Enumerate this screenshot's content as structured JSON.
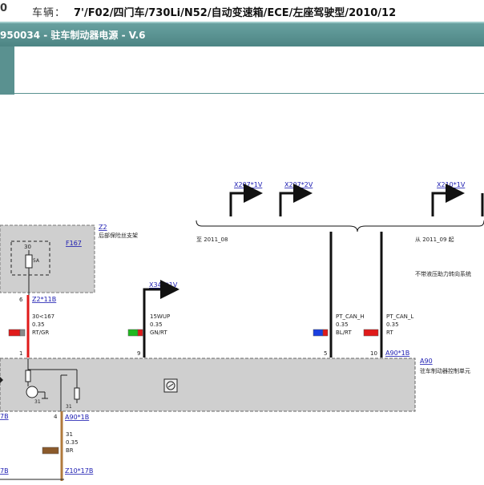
{
  "header": {
    "left_mark": "0",
    "vehicle_label": "车辆：",
    "vehicle_value": "7'/F02/四门车/730Li/N52/自动变速箱/ECE/左座驾驶型/2010/12"
  },
  "title": "950034 - 驻车制动器电源 - V.6",
  "connectors_top": [
    "X207*1V",
    "X207*2V",
    "X210*1V"
  ],
  "notes": {
    "until": "至 2011_08",
    "from": "从 2011_09 起",
    "no_hydraulic": "不带液压助力转向系统"
  },
  "z2": {
    "id": "Z2",
    "desc": "后部保险丝支架",
    "fuse_ref": "F167",
    "pin_top": "30",
    "fuse_rating": "5A",
    "pin_out": "6",
    "conn": "Z2*11B"
  },
  "x344": {
    "conn": "X344*1V"
  },
  "wires": [
    {
      "name": "30<167",
      "size": "0.35",
      "color": "RT/GR",
      "pin": "1"
    },
    {
      "name": "15WUP",
      "size": "0.35",
      "color": "GN/RT",
      "pin": "9"
    },
    {
      "name": "PT_CAN_H",
      "size": "0.35",
      "color": "BL/RT",
      "pin": "5"
    },
    {
      "name": "PT_CAN_L",
      "size": "0.35",
      "color": "RT",
      "pin": "10"
    },
    {
      "name": "31",
      "size": "0.35",
      "color": "BR",
      "pin": "4"
    }
  ],
  "a90": {
    "id": "A90",
    "desc": "驻车制动器控制单元",
    "conn": "A90*1B",
    "conn_bottom": "A90*1B",
    "pin31_a": "31",
    "pin31_b": "31"
  },
  "bottom": {
    "conn": "Z10*17B",
    "left_cut": "7B",
    "left_cut2": "7B"
  },
  "colors": {
    "teal": "#5a9190",
    "wire_red": "#e01a1a",
    "wire_black": "#111111",
    "wire_brown": "#b07a3c",
    "box_grey": "#cfcfcf",
    "link_blue": "#1a1ab0"
  }
}
